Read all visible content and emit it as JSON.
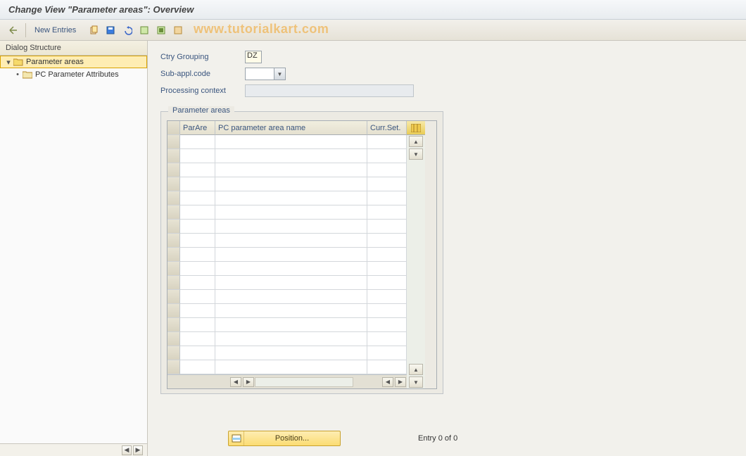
{
  "title": "Change View \"Parameter areas\": Overview",
  "watermark": "www.tutorialkart.com",
  "toolbar": {
    "new_entries": "New Entries"
  },
  "sidebar": {
    "header": "Dialog Structure",
    "node1": "Parameter areas",
    "node2": "PC Parameter Attributes"
  },
  "fields": {
    "ctry_label": "Ctry Grouping",
    "ctry_value": "DZ",
    "subappl_label": "Sub-appl.code",
    "procctx_label": "Processing context"
  },
  "panel": {
    "title": "Parameter areas",
    "cols": {
      "parare": "ParAre",
      "name": "PC parameter area name",
      "currset": "Curr.Set."
    }
  },
  "footer": {
    "position": "Position...",
    "entry": "Entry 0 of 0"
  }
}
